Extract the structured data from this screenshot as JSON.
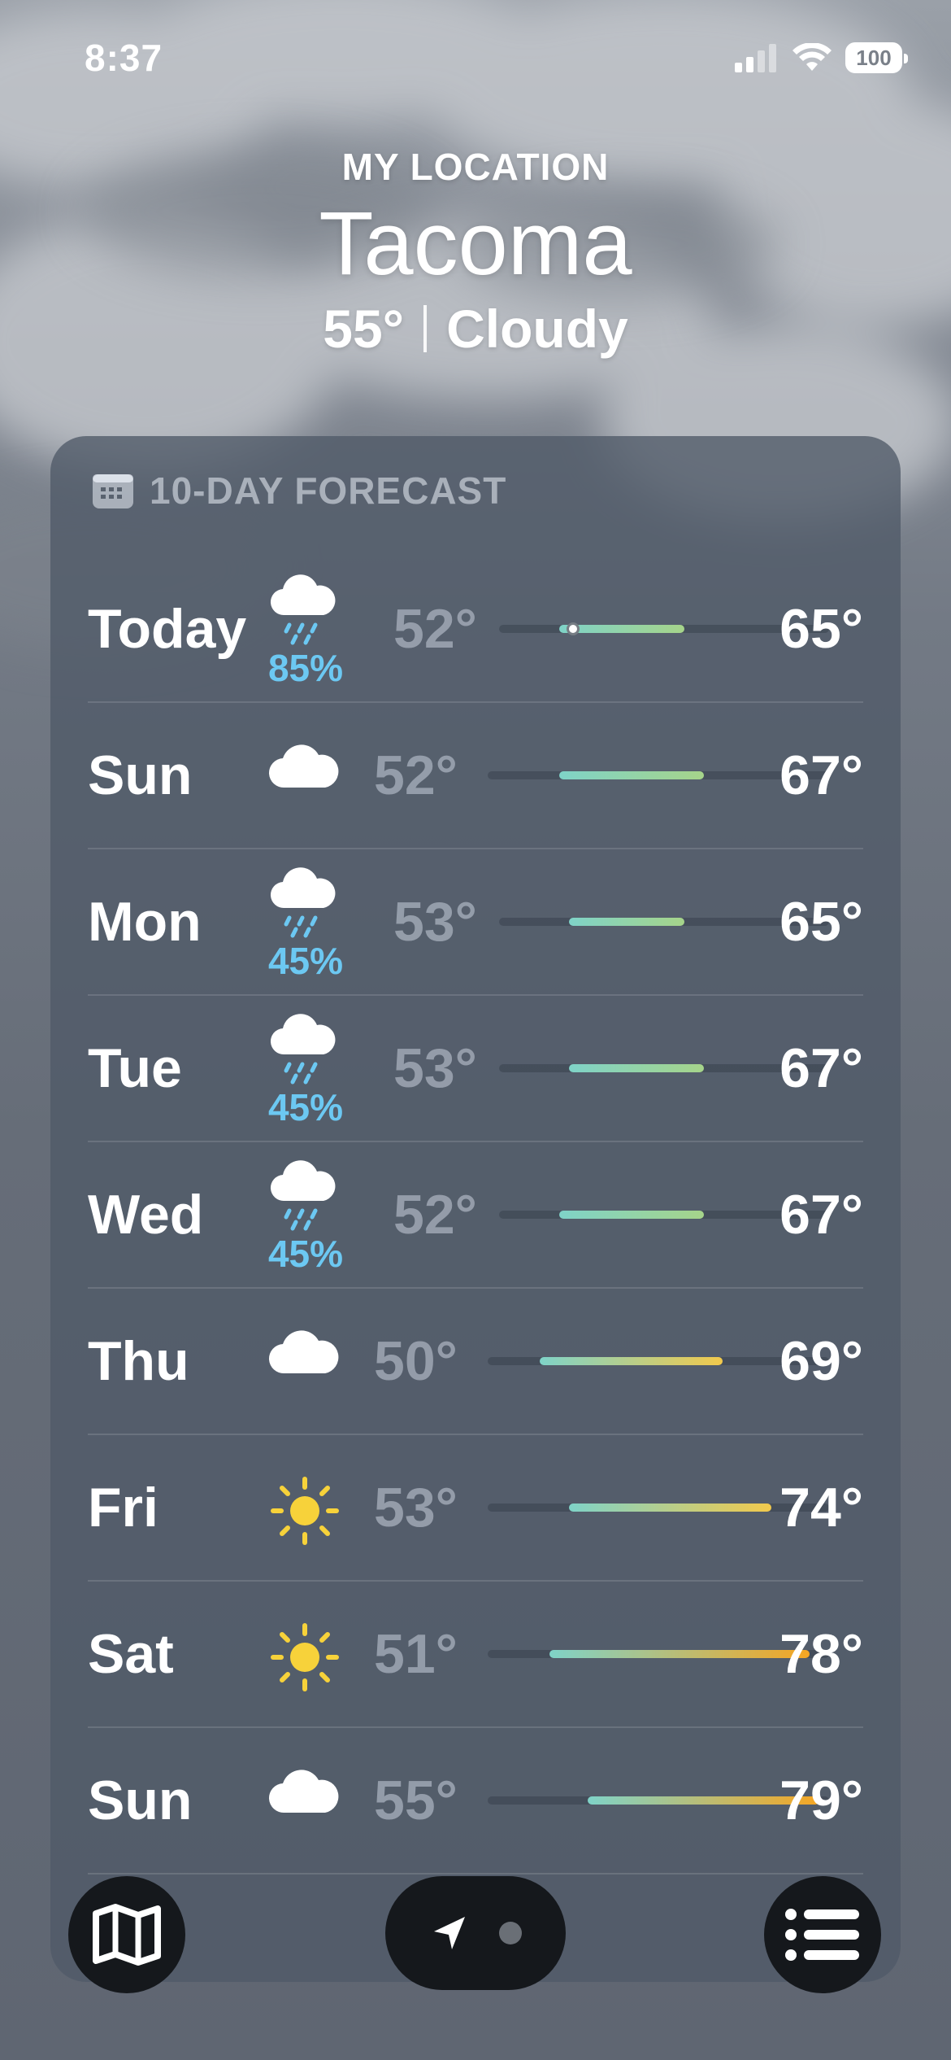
{
  "status_bar": {
    "time": "8:37",
    "battery": "100"
  },
  "header": {
    "location_label": "MY LOCATION",
    "city": "Tacoma",
    "current_temp": "55°",
    "condition": "Cloudy"
  },
  "forecast": {
    "title": "10-DAY FORECAST",
    "range_min": 50,
    "range_max": 79,
    "days": [
      {
        "day": "Today",
        "icon": "cloud-rain-icon",
        "precip": "85%",
        "low": "52°",
        "high": "65°",
        "low_val": 52,
        "high_val": 65,
        "current": 55
      },
      {
        "day": "Sun",
        "icon": "cloud-icon",
        "precip": "",
        "low": "52°",
        "high": "67°",
        "low_val": 52,
        "high_val": 67
      },
      {
        "day": "Mon",
        "icon": "cloud-rain-icon",
        "precip": "45%",
        "low": "53°",
        "high": "65°",
        "low_val": 53,
        "high_val": 65
      },
      {
        "day": "Tue",
        "icon": "cloud-rain-icon",
        "precip": "45%",
        "low": "53°",
        "high": "67°",
        "low_val": 53,
        "high_val": 67
      },
      {
        "day": "Wed",
        "icon": "cloud-rain-icon",
        "precip": "45%",
        "low": "52°",
        "high": "67°",
        "low_val": 52,
        "high_val": 67
      },
      {
        "day": "Thu",
        "icon": "cloud-icon",
        "precip": "",
        "low": "50°",
        "high": "69°",
        "low_val": 50,
        "high_val": 69
      },
      {
        "day": "Fri",
        "icon": "sun-icon",
        "precip": "",
        "low": "53°",
        "high": "74°",
        "low_val": 53,
        "high_val": 74
      },
      {
        "day": "Sat",
        "icon": "sun-icon",
        "precip": "",
        "low": "51°",
        "high": "78°",
        "low_val": 51,
        "high_val": 78
      },
      {
        "day": "Sun",
        "icon": "cloud-icon",
        "precip": "",
        "low": "55°",
        "high": "79°",
        "low_val": 55,
        "high_val": 79
      }
    ]
  },
  "colors": {
    "precip": "#6cc8f2",
    "sun": "#f7d23a",
    "cool": "#7fd3c8",
    "mild": "#a6d48a",
    "warm": "#f2c94c",
    "hot": "#f5a623"
  },
  "toolbar": {
    "map_icon": "map-icon",
    "location_icon": "location-arrow-icon",
    "list_icon": "list-icon"
  }
}
